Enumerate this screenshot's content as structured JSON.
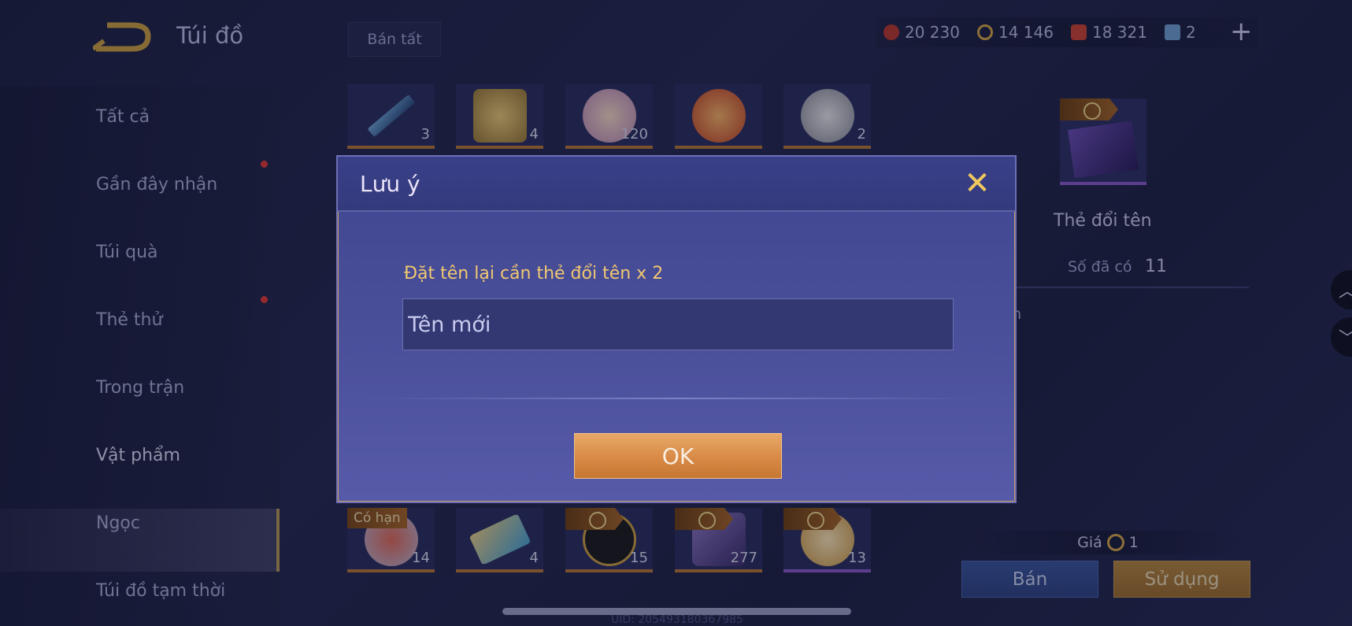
{
  "header": {
    "title": "Túi đồ",
    "sell_all_label": "Bán tất",
    "currencies": [
      {
        "icon": "ruby-icon",
        "value": "20 230",
        "color": "#c0392b"
      },
      {
        "icon": "gold-coin-icon",
        "value": "14 146",
        "color": "#d4a84a"
      },
      {
        "icon": "voucher-icon",
        "value": "18 321",
        "color": "#d0473e"
      },
      {
        "icon": "card-icon",
        "value": "2",
        "color": "#7fb0e0"
      }
    ],
    "add_label": "+"
  },
  "sidebar": {
    "items": [
      {
        "label": "Tất cả"
      },
      {
        "label": "Gần đây nhận"
      },
      {
        "label": "Túi quà"
      },
      {
        "label": "Thẻ thử"
      },
      {
        "label": "Trong trận"
      },
      {
        "label": "Vật phẩm"
      },
      {
        "label": "Ngọc"
      },
      {
        "label": "Túi đồ tạm thời"
      }
    ]
  },
  "grid": {
    "top_row_counts": [
      "3",
      "4",
      "120",
      "",
      "2"
    ],
    "bottom_row_counts": [
      "14",
      "4",
      "15",
      "277",
      "13"
    ],
    "limited_badge": "Có hạn"
  },
  "detail": {
    "name": "Thẻ đổi tên",
    "owned_label": "Số đã có",
    "owned_value": "11",
    "description_fragment": "tên",
    "price_label": "Giá",
    "price_value": "1",
    "sell_label": "Bán",
    "use_label": "Sử dụng"
  },
  "footer": {
    "uid": "UID: 205493180367985"
  },
  "dialog": {
    "title": "Lưu ý",
    "message": "Đặt tên lại cần thẻ đổi tên x 2",
    "input_placeholder": "Tên mới",
    "ok_label": "OK"
  }
}
